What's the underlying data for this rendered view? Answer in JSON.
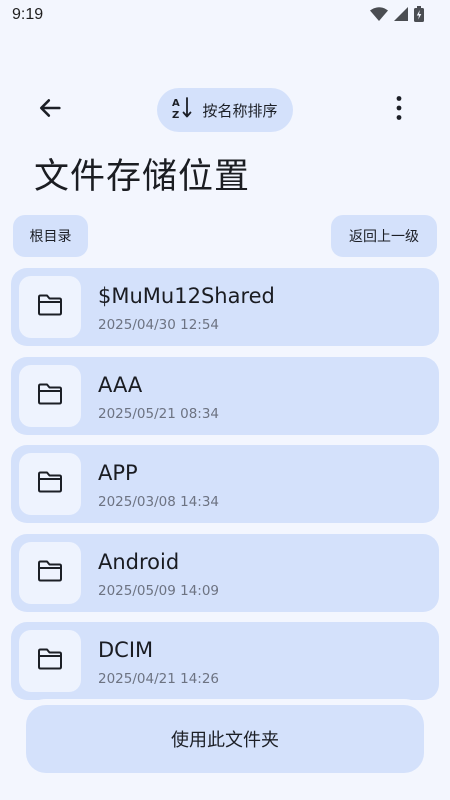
{
  "status_bar": {
    "time": "9:19",
    "icons": [
      "wifi-icon",
      "signal-icon",
      "battery-icon"
    ]
  },
  "app_bar": {
    "back_icon": "arrow-left-icon",
    "sort_icon": "sort-az-icon",
    "sort_label": "按名称排序",
    "more_icon": "more-vert-icon"
  },
  "page": {
    "title": "文件存储位置"
  },
  "nav": {
    "root_label": "根目录",
    "up_label": "返回上一级"
  },
  "folders": [
    {
      "name": "$MuMu12Shared",
      "date": "2025/04/30 12:54",
      "icon": "folder-icon"
    },
    {
      "name": "AAA",
      "date": "2025/05/21 08:34",
      "icon": "folder-icon"
    },
    {
      "name": "APP",
      "date": "2025/03/08 14:34",
      "icon": "folder-icon"
    },
    {
      "name": "Android",
      "date": "2025/05/09 14:09",
      "icon": "folder-icon"
    },
    {
      "name": "DCIM",
      "date": "2025/04/21 14:26",
      "icon": "folder-icon"
    }
  ],
  "footer": {
    "use_folder_label": "使用此文件夹"
  },
  "colors": {
    "background": "#f3f6fe",
    "surface_tonal": "#d4e1fb",
    "icon_box": "#eef3fe",
    "text_primary": "#1a1c22",
    "text_secondary": "#6d7382"
  }
}
